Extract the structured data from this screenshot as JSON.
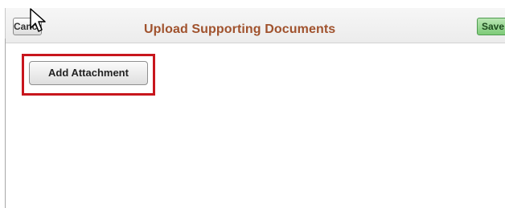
{
  "header": {
    "cancel_label": "Cancel",
    "title": "Upload Supporting Documents",
    "save_label": "Save"
  },
  "main": {
    "add_attachment_label": "Add Attachment"
  },
  "colors": {
    "title": "#a0522d",
    "save_button": "#7ecb79",
    "highlight": "#c8161d"
  },
  "icons": {
    "cursor": "mouse-pointer-icon"
  }
}
